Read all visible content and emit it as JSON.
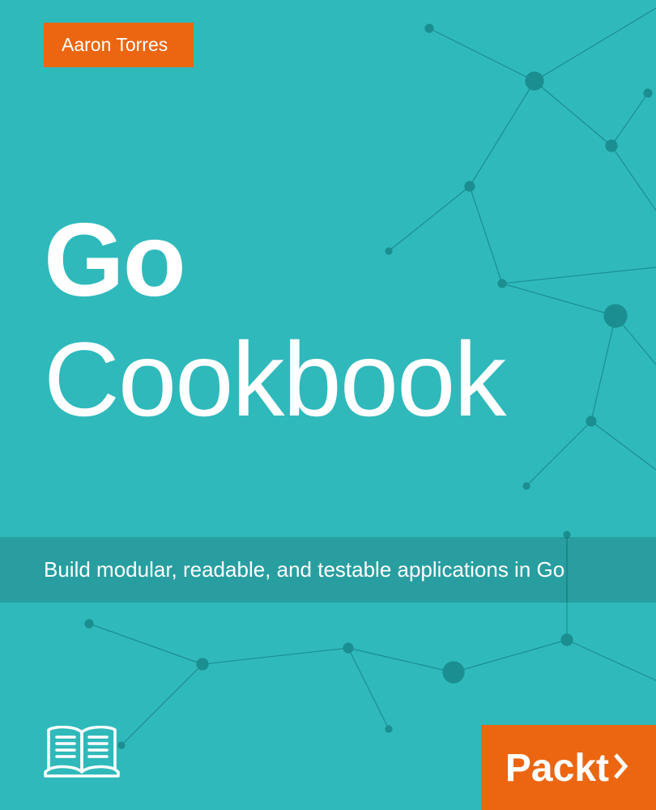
{
  "author": "Aaron Torres",
  "title": {
    "line1": "Go",
    "line2": "Cookbook"
  },
  "subtitle": "Build modular, readable, and testable applications in Go",
  "publisher": "Packt",
  "colors": {
    "background": "#2fb9bb",
    "accent": "#ec6611",
    "text": "#ffffff"
  }
}
